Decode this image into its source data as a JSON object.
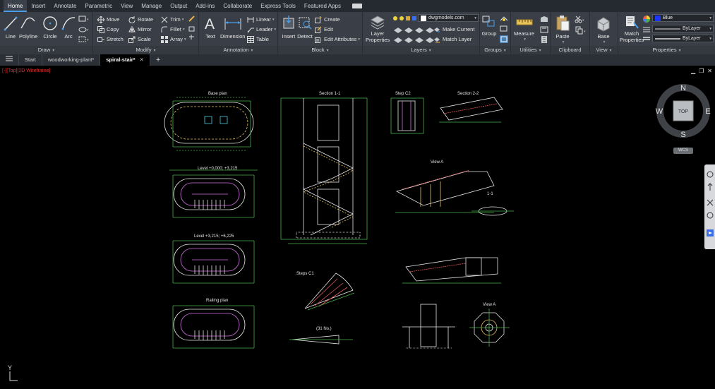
{
  "tabs": [
    "Home",
    "Insert",
    "Annotate",
    "Parametric",
    "View",
    "Manage",
    "Output",
    "Add-ins",
    "Collaborate",
    "Express Tools",
    "Featured Apps"
  ],
  "active_tab": "Home",
  "draw": {
    "title": "Draw",
    "line": "Line",
    "polyline": "Polyline",
    "circle": "Circle",
    "arc": "Arc"
  },
  "modify": {
    "title": "Modify",
    "move": "Move",
    "rotate": "Rotate",
    "trim": "Trim",
    "copy": "Copy",
    "mirror": "Mirror",
    "fillet": "Fillet",
    "stretch": "Stretch",
    "scale": "Scale",
    "array": "Array"
  },
  "annotation": {
    "title": "Annotation",
    "text": "Text",
    "dimension": "Dimension",
    "linear": "Linear",
    "leader": "Leader",
    "table": "Table"
  },
  "block": {
    "title": "Block",
    "insert": "Insert",
    "detect": "Detect",
    "create": "Create",
    "edit": "Edit",
    "edit_attributes": "Edit Attributes"
  },
  "layers": {
    "title": "Layers",
    "layer_properties": "Layer Properties",
    "current_layer": "dwgmodels.com",
    "make_current": "Make Current",
    "match_layer": "Match Layer"
  },
  "groups": {
    "title": "Groups",
    "group": "Group"
  },
  "utilities": {
    "title": "Utilities",
    "measure": "Measure"
  },
  "clipboard": {
    "title": "Clipboard",
    "paste": "Paste"
  },
  "view": {
    "title": "View",
    "base": "Base"
  },
  "properties": {
    "title": "Properties",
    "match_properties": "Match Properties",
    "color": "Blue",
    "linetype": "ByLayer",
    "lineweight": "ByLayer"
  },
  "file_tabs": [
    {
      "label": "Start"
    },
    {
      "label": "woodworking-plant*"
    },
    {
      "label": "spiral-stair*"
    }
  ],
  "view_label": "[-][Top][2D Wireframe]",
  "viewcube": {
    "n": "N",
    "s": "S",
    "e": "E",
    "w": "W",
    "face": "TOP",
    "wcs": "WCS"
  },
  "ucs_label": "Y",
  "colors": {
    "accent": "#4a9dea",
    "layer_color": "#1e35ff",
    "view_label": "#e03030"
  },
  "drawing_labels": {
    "base_plan": "Base plan",
    "level1": "Level +0,000; +3,215",
    "level2": "Level +3,215; +6,225",
    "railing_plan": "Railing plan",
    "section_11": "Section 1-1",
    "step_c2": "Step C2",
    "section_22": "Section 2-2",
    "view_a_top": "View A",
    "detail_11": "1-1",
    "steps_c1": "Steps C1",
    "count": "(31 No.)",
    "view_a_bottom": "View A"
  }
}
